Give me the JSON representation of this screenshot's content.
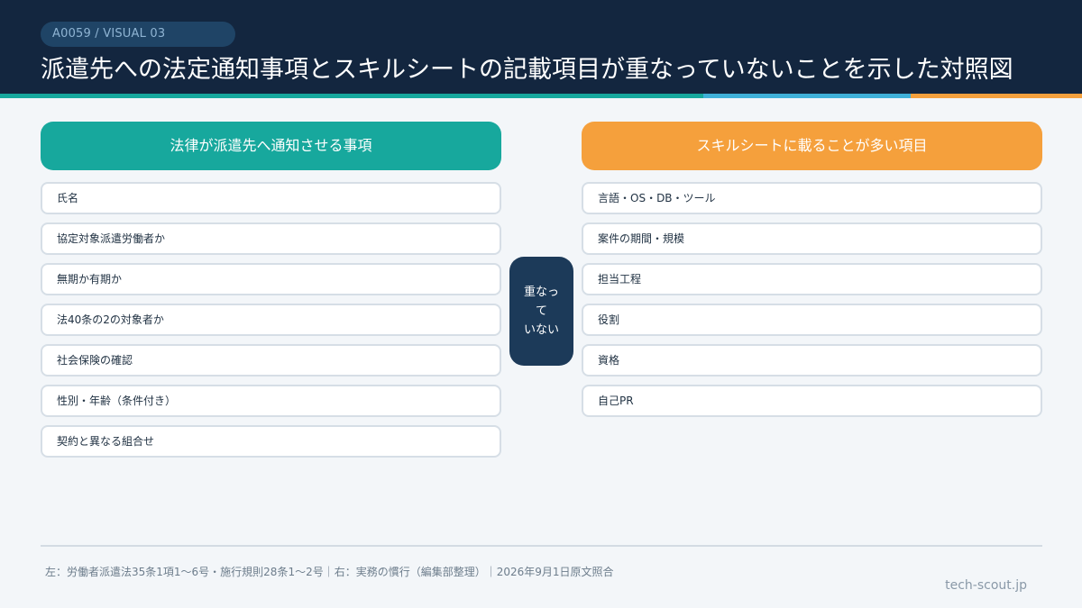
{
  "colors": {
    "header_bg": "#13263f",
    "teal": "#17a89d",
    "blue": "#3fb0d8",
    "orange": "#f5a03c",
    "center_bg": "#1c3a59"
  },
  "header": {
    "badge": "A0059 / VISUAL 03",
    "title": "派遣先への法定通知事項とスキルシートの記載項目が重なっていないことを示した対照図"
  },
  "left": {
    "heading": "法律が派遣先へ通知させる事項",
    "items": [
      "氏名",
      "協定対象派遣労働者か",
      "無期か有期か",
      "法40条の2の対象者か",
      "社会保険の確認",
      "性別・年齢（条件付き）",
      "契約と異なる組合せ"
    ]
  },
  "center": {
    "lines": [
      "重なっ",
      "て",
      "いない"
    ]
  },
  "right": {
    "heading": "スキルシートに載ることが多い項目",
    "items": [
      "言語・OS・DB・ツール",
      "案件の期間・規模",
      "担当工程",
      "役割",
      "資格",
      "自己PR"
    ]
  },
  "footer": {
    "note": "左：労働者派遣法35条1項1〜6号・施行規則28条1〜2号｜右：実務の慣行（編集部整理）｜2026年9月1日原文照合",
    "brand": "tech-scout.jp"
  }
}
